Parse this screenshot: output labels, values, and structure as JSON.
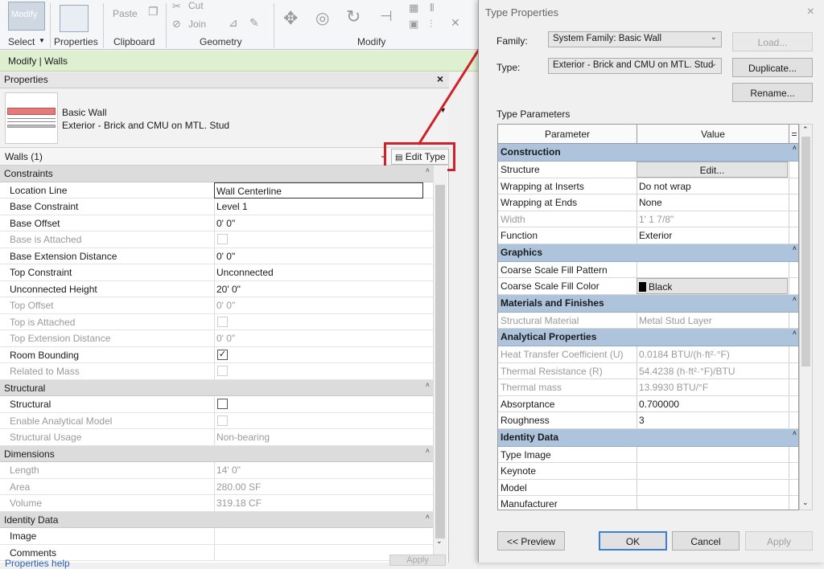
{
  "ribbon": {
    "groups": [
      {
        "label": "Select"
      },
      {
        "label": "Properties"
      },
      {
        "label": "Clipboard"
      },
      {
        "label": "Geometry"
      },
      {
        "label": "Modify"
      }
    ],
    "modify_label": "Modify",
    "paste_label": "Paste",
    "cut_label": "Cut",
    "join_label": "Join"
  },
  "context_bar": {
    "text": "Modify | Walls"
  },
  "properties": {
    "header": "Properties",
    "close": "×",
    "type_family": "Basic Wall",
    "type_name": "Exterior - Brick and CMU on MTL. Stud",
    "instance": "Walls (1)",
    "edit_type_label": "Edit Type",
    "help_link": "Properties help",
    "apply_label": "Apply",
    "categories": [
      {
        "name": "Constraints",
        "rows": [
          {
            "name": "Location Line",
            "value": "Wall Centerline",
            "editable": true,
            "boxed": true
          },
          {
            "name": "Base Constraint",
            "value": "Level 1",
            "editable": true
          },
          {
            "name": "Base Offset",
            "value": "0'  0\"",
            "editable": true
          },
          {
            "name": "Base is Attached",
            "check": false,
            "editable": false
          },
          {
            "name": "Base Extension Distance",
            "value": "0'  0\"",
            "editable": true
          },
          {
            "name": "Top Constraint",
            "value": "Unconnected",
            "editable": true
          },
          {
            "name": "Unconnected Height",
            "value": "20'  0\"",
            "editable": true
          },
          {
            "name": "Top Offset",
            "value": "0'  0\"",
            "editable": false
          },
          {
            "name": "Top is Attached",
            "check": false,
            "editable": false
          },
          {
            "name": "Top Extension Distance",
            "value": "0'  0\"",
            "editable": false
          },
          {
            "name": "Room Bounding",
            "check": true,
            "editable": true
          },
          {
            "name": "Related to Mass",
            "check": false,
            "editable": false
          }
        ]
      },
      {
        "name": "Structural",
        "rows": [
          {
            "name": "Structural",
            "check": false,
            "editable": true
          },
          {
            "name": "Enable Analytical Model",
            "check": false,
            "editable": false
          },
          {
            "name": "Structural Usage",
            "value": "Non-bearing",
            "editable": false
          }
        ]
      },
      {
        "name": "Dimensions",
        "rows": [
          {
            "name": "Length",
            "value": "14'  0\"",
            "editable": false
          },
          {
            "name": "Area",
            "value": "280.00 SF",
            "editable": false
          },
          {
            "name": "Volume",
            "value": "319.18 CF",
            "editable": false
          }
        ]
      },
      {
        "name": "Identity Data",
        "rows": [
          {
            "name": "Image",
            "value": "",
            "editable": true
          },
          {
            "name": "Comments",
            "value": "",
            "editable": true
          }
        ]
      }
    ]
  },
  "type_dialog": {
    "title": "Type Properties",
    "close": "×",
    "family_label": "Family:",
    "family_value": "System Family: Basic Wall",
    "type_label": "Type:",
    "type_value": "Exterior - Brick and CMU on MTL. Stud",
    "load_label": "Load...",
    "duplicate_label": "Duplicate...",
    "rename_label": "Rename...",
    "type_parameters_label": "Type Parameters",
    "col_parameter": "Parameter",
    "col_value": "Value",
    "col_eq": "=",
    "preview_label": "<< Preview",
    "ok_label": "OK",
    "cancel_label": "Cancel",
    "apply_label": "Apply",
    "categories": [
      {
        "name": "Construction",
        "rows": [
          {
            "name": "Structure",
            "value": "Edit...",
            "button": true,
            "editable": true
          },
          {
            "name": "Wrapping at Inserts",
            "value": "Do not wrap",
            "editable": true
          },
          {
            "name": "Wrapping at Ends",
            "value": "None",
            "editable": true
          },
          {
            "name": "Width",
            "value": "1'  1 7/8\"",
            "editable": false
          },
          {
            "name": "Function",
            "value": "Exterior",
            "editable": true
          }
        ]
      },
      {
        "name": "Graphics",
        "rows": [
          {
            "name": "Coarse Scale Fill Pattern",
            "value": "",
            "editable": true
          },
          {
            "name": "Coarse Scale Fill Color",
            "value": "Black",
            "button": true,
            "swatch": true,
            "editable": true
          }
        ]
      },
      {
        "name": "Materials and Finishes",
        "rows": [
          {
            "name": "Structural Material",
            "value": "Metal Stud Layer",
            "editable": false
          }
        ]
      },
      {
        "name": "Analytical Properties",
        "rows": [
          {
            "name": "Heat Transfer Coefficient (U)",
            "value": "0.0184 BTU/(h·ft²·°F)",
            "editable": false
          },
          {
            "name": "Thermal Resistance (R)",
            "value": "54.4238 (h·ft²·°F)/BTU",
            "editable": false
          },
          {
            "name": "Thermal mass",
            "value": "13.9930 BTU/°F",
            "editable": false
          },
          {
            "name": "Absorptance",
            "value": "0.700000",
            "editable": true
          },
          {
            "name": "Roughness",
            "value": "3",
            "editable": true
          }
        ]
      },
      {
        "name": "Identity Data",
        "rows": [
          {
            "name": "Type Image",
            "value": "",
            "editable": true
          },
          {
            "name": "Keynote",
            "value": "",
            "editable": true
          },
          {
            "name": "Model",
            "value": "",
            "editable": true
          },
          {
            "name": "Manufacturer",
            "value": "",
            "editable": true
          }
        ]
      }
    ]
  },
  "colors": {
    "highlight_red": "#d0202a",
    "category_blue": "#aec4dd",
    "context_green": "#dff0d0"
  }
}
